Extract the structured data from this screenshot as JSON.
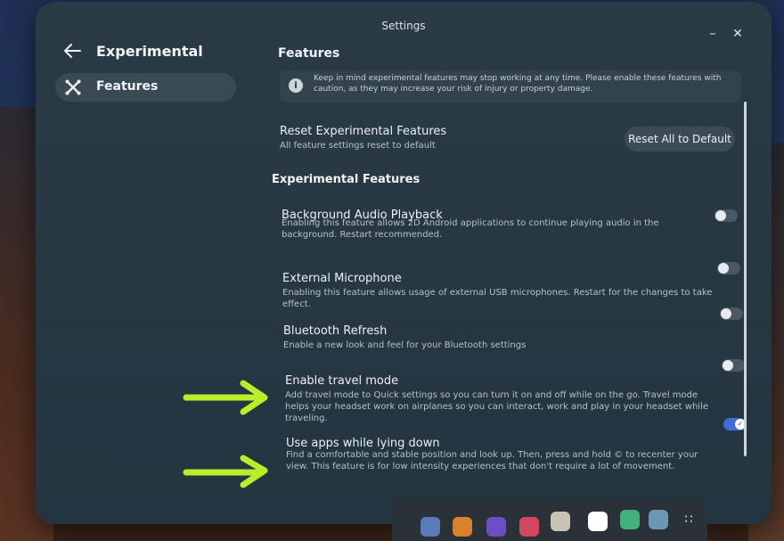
{
  "window": {
    "title": "Settings"
  },
  "sidebar": {
    "title": "Experimental",
    "items": [
      {
        "label": "Features",
        "icon": "tools-icon"
      }
    ]
  },
  "main": {
    "title": "Features",
    "info_text": "Keep in mind experimental features may stop working at any time. Please enable these features with caution, as they may increase your risk of injury or property damage.",
    "reset": {
      "title": "Reset Experimental Features",
      "desc": "All feature settings reset to default",
      "button_label": "Reset All to Default"
    },
    "section_title": "Experimental Features",
    "features": [
      {
        "title": "Background Audio Playback",
        "desc": "Enabling this feature allows 2D Android applications to continue playing audio in the background. Restart recommended.",
        "enabled": false
      },
      {
        "title": "External Microphone",
        "desc": "Enabling this feature allows usage of external USB microphones. Restart for the changes to take effect.",
        "enabled": false
      },
      {
        "title": "Bluetooth Refresh",
        "desc": "Enable a new look and feel for your Bluetooth settings",
        "enabled": false
      },
      {
        "title": "Enable travel mode",
        "desc": "Add travel mode to Quick settings so you can turn it on and off while on the go. Travel mode helps your headset work on airplanes so you can interact, work and play in your headset while traveling.",
        "enabled": false
      },
      {
        "title": "Use apps while lying down",
        "desc": "Find a comfortable and stable position and look up. Then, press and hold © to recenter your view. This feature is for low intensity experiences that don't require a lot of movement.",
        "enabled": true
      }
    ]
  },
  "colors": {
    "accent": "#3f6bd8",
    "arrow": "#b8ef2a"
  }
}
